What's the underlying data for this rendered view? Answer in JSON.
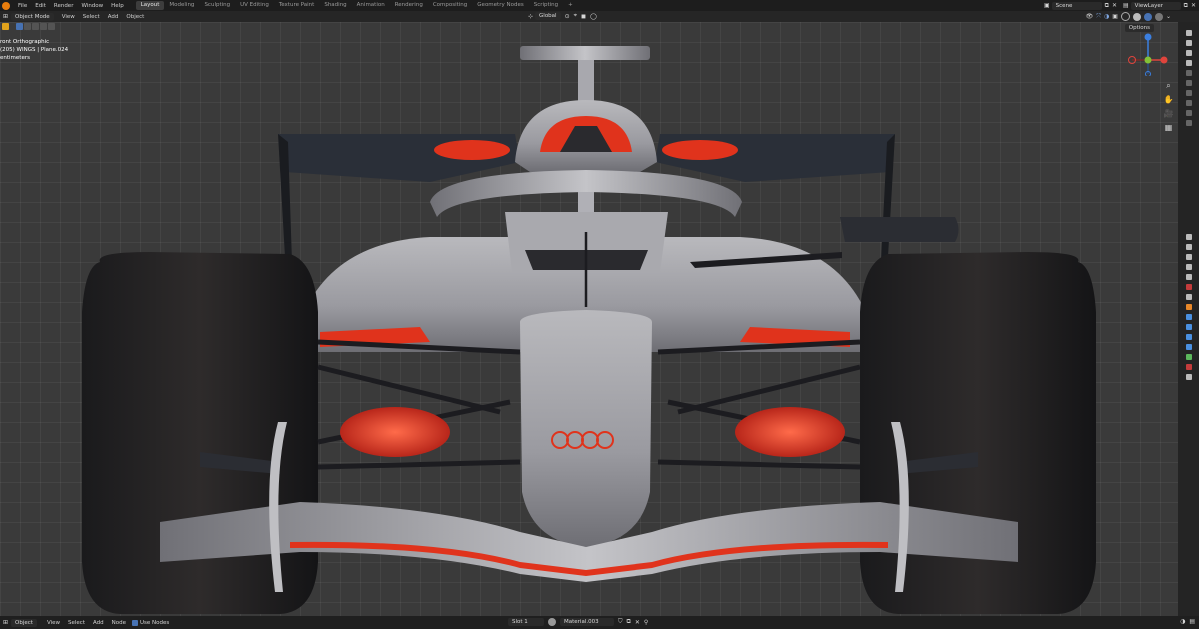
{
  "topbar": {
    "menus": [
      "File",
      "Edit",
      "Render",
      "Window",
      "Help"
    ],
    "workspace_tabs": [
      "Layout",
      "Modeling",
      "Sculpting",
      "UV Editing",
      "Texture Paint",
      "Shading",
      "Animation",
      "Rendering",
      "Compositing",
      "Geometry Nodes",
      "Scripting"
    ],
    "active_tab": "Layout",
    "add_tab": "+",
    "scene": "Scene",
    "view_layer": "ViewLayer"
  },
  "header": {
    "mode": "Object Mode",
    "menus": [
      "View",
      "Select",
      "Add",
      "Object"
    ],
    "transform_orientation": "Global"
  },
  "viewport": {
    "view_name": "Front Orthographic",
    "view_name_visible": "ront Orthographic",
    "object_info": "(205) WINGS | Plane.024",
    "units": "entimeters",
    "options_label": "Options"
  },
  "statusbar": {
    "editor_type": "Object",
    "menus": [
      "View",
      "Select",
      "Add",
      "Node"
    ],
    "use_nodes_label": "Use Nodes",
    "slot": "Slot 1",
    "material": "Material.003"
  },
  "colors": {
    "accent_blue": "#4772b3",
    "livery_red": "#e0331c",
    "axis_x": "#e0443c",
    "axis_y": "#83c136",
    "axis_z": "#3b7fe0"
  }
}
